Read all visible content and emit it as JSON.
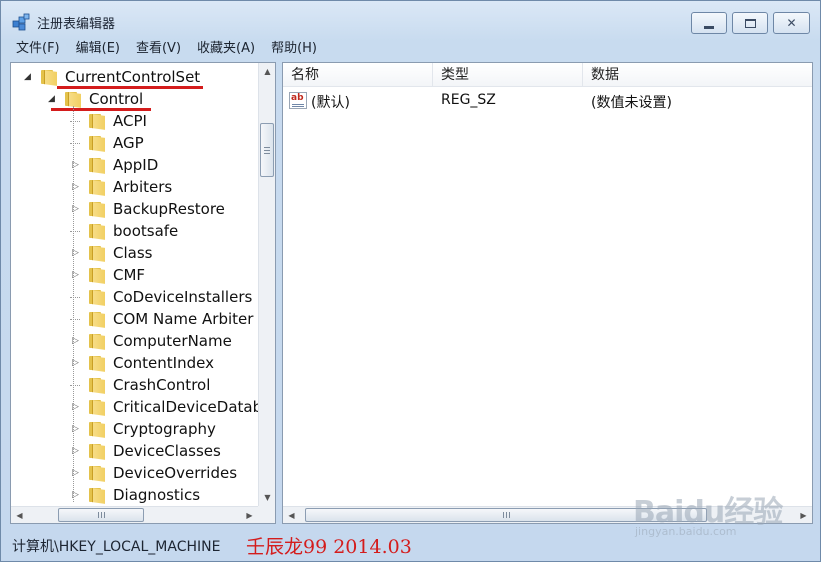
{
  "window": {
    "title": "注册表编辑器",
    "icon": "registry-editor-icon"
  },
  "menu": [
    "文件(F)",
    "编辑(E)",
    "查看(V)",
    "收藏夹(A)",
    "帮助(H)"
  ],
  "tree": {
    "items": [
      {
        "label": "CurrentControlSet",
        "expanded": true,
        "annotated": true
      },
      {
        "label": "Control",
        "expanded": true,
        "annotated": true
      },
      {
        "label": "ACPI",
        "has_children": false
      },
      {
        "label": "AGP",
        "has_children": false
      },
      {
        "label": "AppID",
        "has_children": true
      },
      {
        "label": "Arbiters",
        "has_children": true
      },
      {
        "label": "BackupRestore",
        "has_children": true
      },
      {
        "label": "bootsafe",
        "has_children": false
      },
      {
        "label": "Class",
        "has_children": true
      },
      {
        "label": "CMF",
        "has_children": true
      },
      {
        "label": "CoDeviceInstallers",
        "has_children": false
      },
      {
        "label": "COM Name Arbiter",
        "has_children": false
      },
      {
        "label": "ComputerName",
        "has_children": true
      },
      {
        "label": "ContentIndex",
        "has_children": true
      },
      {
        "label": "CrashControl",
        "has_children": false
      },
      {
        "label": "CriticalDeviceDatab",
        "has_children": true
      },
      {
        "label": "Cryptography",
        "has_children": true
      },
      {
        "label": "DeviceClasses",
        "has_children": true
      },
      {
        "label": "DeviceOverrides",
        "has_children": true
      },
      {
        "label": "Diagnostics",
        "has_children": true
      }
    ]
  },
  "list": {
    "columns": [
      "名称",
      "类型",
      "数据"
    ],
    "rows": [
      {
        "name": "(默认)",
        "type": "REG_SZ",
        "data": "(数值未设置)",
        "icon": "string-value-icon"
      }
    ]
  },
  "status": {
    "path": "计算机\\HKEY_LOCAL_MACHINE",
    "annotation": "壬辰龙99  2014.03"
  },
  "watermark": {
    "brand": "Baidu经验",
    "url": "jingyan.baidu.com"
  },
  "colors": {
    "annotation_red": "#d41c1c",
    "folder_yellow": "#f1cf63"
  }
}
